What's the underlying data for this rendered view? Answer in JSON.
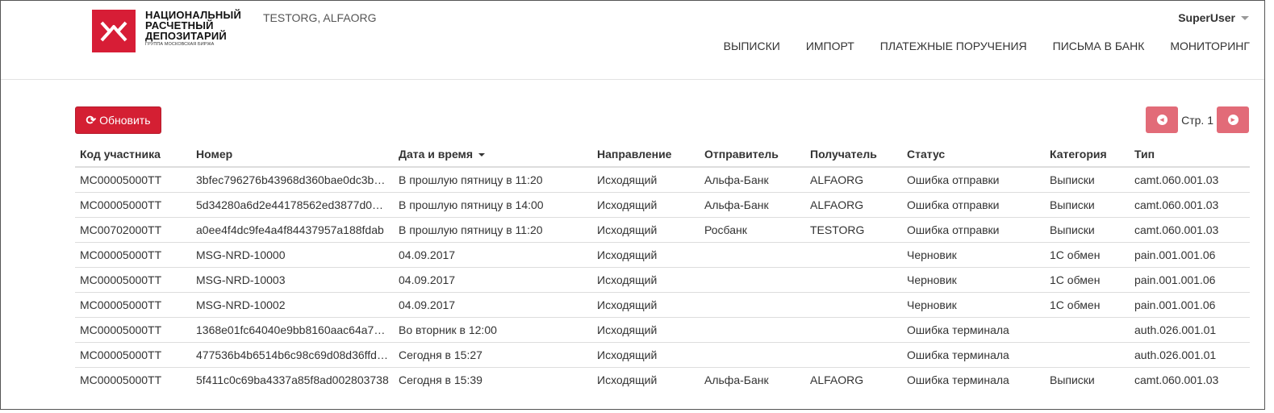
{
  "logo": {
    "line1": "НАЦИОНАЛЬНЫЙ",
    "line2": "РАСЧЕТНЫЙ",
    "line3": "ДЕПОЗИТАРИЙ",
    "sub": "ГРУППА МОСКОВСКАЯ БИРЖА",
    "brand_color": "#d71d36"
  },
  "org": "TESTORG, ALFAORG",
  "user": "SuperUser",
  "nav": [
    "ВЫПИСКИ",
    "ИМПОРТ",
    "ПЛАТЕЖНЫЕ ПОРУЧЕНИЯ",
    "ПИСЬМА В БАНК",
    "МОНИТОРИНГ"
  ],
  "toolbar": {
    "refresh_label": "Обновить",
    "refresh_icon": "refresh-icon"
  },
  "pager": {
    "page_label": "Стр. 1",
    "prev_icon": "arrow-left-circle-icon",
    "next_icon": "arrow-right-circle-icon"
  },
  "table": {
    "columns": [
      "Код участника",
      "Номер",
      "Дата и время",
      "Направление",
      "Отправитель",
      "Получатель",
      "Статус",
      "Категория",
      "Тип"
    ],
    "sorted_column": "Дата и время",
    "rows": [
      [
        "MC00005000TT",
        "3bfec796276b43968d360bae0dc3be…",
        "В прошлую пятницу в 11:20",
        "Исходящий",
        "Альфа-Банк",
        "ALFAORG",
        "Ошибка отправки",
        "Выписки",
        "camt.060.001.03"
      ],
      [
        "MC00005000TT",
        "5d34280a6d2e44178562ed3877d0e…",
        "В прошлую пятницу в 14:00",
        "Исходящий",
        "Альфа-Банк",
        "ALFAORG",
        "Ошибка отправки",
        "Выписки",
        "camt.060.001.03"
      ],
      [
        "MC00702000TT",
        "a0ee4f4dc9fe4a4f84437957a188fdab",
        "В прошлую пятницу в 11:20",
        "Исходящий",
        "Росбанк",
        "TESTORG",
        "Ошибка отправки",
        "Выписки",
        "camt.060.001.03"
      ],
      [
        "MC00005000TT",
        "MSG-NRD-10000",
        "04.09.2017",
        "Исходящий",
        "",
        "",
        "Черновик",
        "1С обмен",
        "pain.001.001.06"
      ],
      [
        "MC00005000TT",
        "MSG-NRD-10003",
        "04.09.2017",
        "Исходящий",
        "",
        "",
        "Черновик",
        "1С обмен",
        "pain.001.001.06"
      ],
      [
        "MC00005000TT",
        "MSG-NRD-10002",
        "04.09.2017",
        "Исходящий",
        "",
        "",
        "Черновик",
        "1С обмен",
        "pain.001.001.06"
      ],
      [
        "MC00005000TT",
        "1368e01fc64040e9bb8160aac64a79…",
        "Во вторник в 12:00",
        "Исходящий",
        "",
        "",
        "Ошибка терминала",
        "",
        "auth.026.001.01"
      ],
      [
        "MC00005000TT",
        "477536b4b6514b6c98c69d08d36ffd97",
        "Сегодня в 15:27",
        "Исходящий",
        "",
        "",
        "Ошибка терминала",
        "",
        "auth.026.001.01"
      ],
      [
        "MC00005000TT",
        "5f411c0c69ba4337a85f8ad002803738",
        "Сегодня в 15:39",
        "Исходящий",
        "Альфа-Банк",
        "ALFAORG",
        "Ошибка терминала",
        "Выписки",
        "camt.060.001.03"
      ]
    ]
  }
}
